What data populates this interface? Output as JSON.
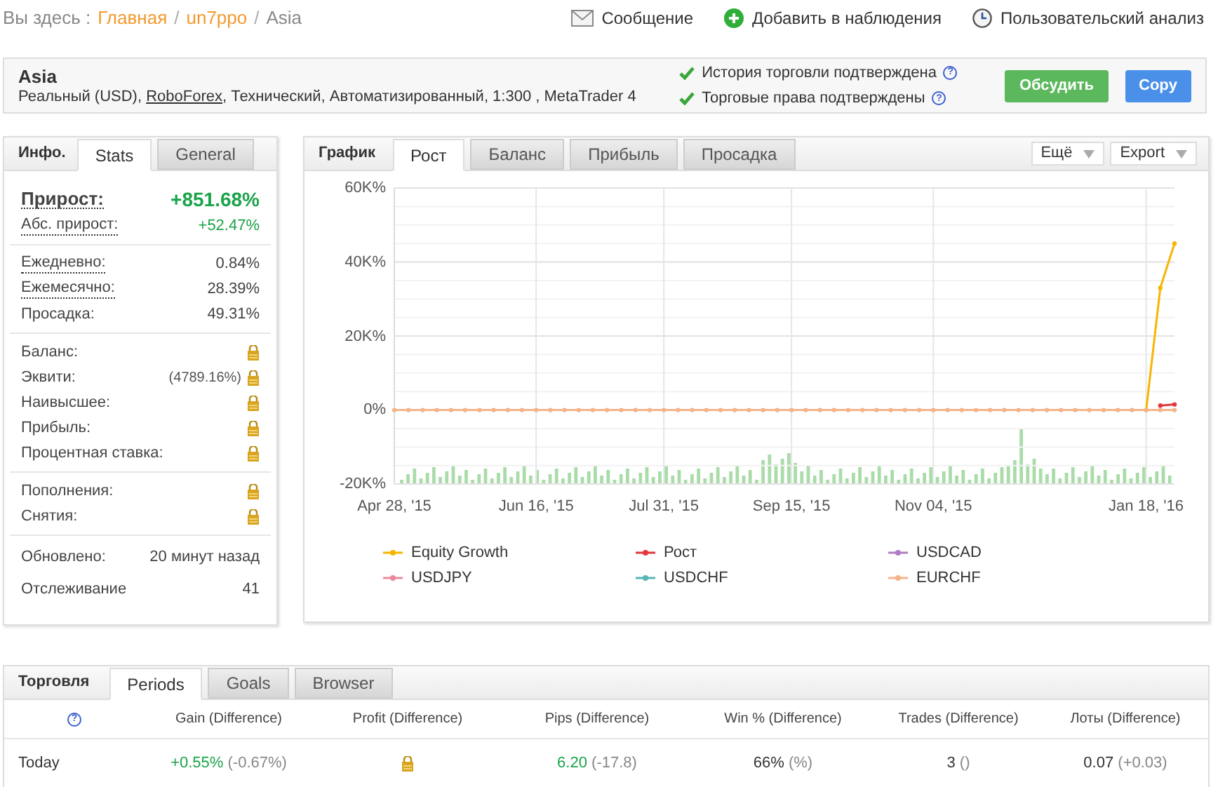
{
  "breadcrumb": {
    "prefix": "Вы здесь :",
    "links": [
      "Главная",
      "un7ppo"
    ],
    "current": "Asia",
    "separator": "/"
  },
  "top_actions": [
    {
      "kind": "message",
      "label": "Сообщение"
    },
    {
      "kind": "watch",
      "label": "Добавить в наблюдения"
    },
    {
      "kind": "analysis",
      "label": "Пользовательский анализ"
    }
  ],
  "account": {
    "title": "Asia",
    "details_before": "Реальный (USD),",
    "broker": "RoboForex",
    "details_after": ", Технический, Автоматизированный, 1:300 , MetaTrader 4",
    "verifications": [
      {
        "label": "История торговли подтверждена",
        "help": "?"
      },
      {
        "label": "Торговые права подтверждены",
        "help": "?"
      }
    ],
    "buttons": [
      {
        "label": "Обсудить",
        "kind": "discuss"
      },
      {
        "label": "Copy",
        "kind": "copy"
      }
    ]
  },
  "info": {
    "title": "Инфо.",
    "tabs": [
      {
        "label": "Stats",
        "selected": true
      },
      {
        "label": "General",
        "selected": false
      }
    ],
    "groups": [
      [
        {
          "label": "Прирост:",
          "value": "+851.68%",
          "kind": "headline",
          "underlined": true
        },
        {
          "label": "Абс. прирост:",
          "value": "+52.47%",
          "kind": "positive",
          "underlined": true
        }
      ],
      [
        {
          "label": "Ежедневно:",
          "value": "0.84%",
          "kind": "plain",
          "underlined": true
        },
        {
          "label": "Ежемесячно:",
          "value": "28.39%",
          "kind": "plain",
          "underlined": true
        },
        {
          "label": "Просадка:",
          "value": "49.31%",
          "kind": "plain",
          "underlined": false
        }
      ],
      [
        {
          "label": "Баланс:",
          "kind": "locked",
          "underlined": false
        },
        {
          "label": "Эквити:",
          "value": "(4789.16%)",
          "kind": "locked",
          "underlined": false
        },
        {
          "label": "Наивысшее:",
          "kind": "locked",
          "underlined": false
        },
        {
          "label": "Прибыль:",
          "kind": "locked",
          "underlined": false
        },
        {
          "label": "Процентная ставка:",
          "kind": "locked",
          "underlined": false
        }
      ],
      [
        {
          "label": "Пополнения:",
          "kind": "locked",
          "underlined": false
        },
        {
          "label": "Снятия:",
          "kind": "locked",
          "underlined": false
        }
      ],
      [
        {
          "label": "Обновлено:",
          "value": "20 минут назад",
          "kind": "plain",
          "underlined": false
        },
        {
          "label": "Отслеживание",
          "value": "41",
          "kind": "plain",
          "underlined": false
        }
      ]
    ]
  },
  "chart_panel": {
    "title": "График",
    "tabs": [
      {
        "label": "Рост",
        "selected": true
      },
      {
        "label": "Баланс",
        "selected": false
      },
      {
        "label": "Прибыль",
        "selected": false
      },
      {
        "label": "Просадка",
        "selected": false
      }
    ],
    "menus": [
      "Ещё",
      "Export"
    ],
    "chart_data": {
      "type": "line",
      "categories": [
        "Apr 28, '15",
        null,
        null,
        null,
        null,
        null,
        null,
        null,
        null,
        null,
        "Jun 16, '15",
        null,
        null,
        null,
        null,
        null,
        null,
        null,
        null,
        "Jul 31, '15",
        null,
        null,
        null,
        null,
        null,
        null,
        null,
        null,
        "Sep 15, '15",
        null,
        null,
        null,
        null,
        null,
        null,
        null,
        null,
        null,
        "Nov 04, '15",
        null,
        null,
        null,
        null,
        null,
        null,
        null,
        null,
        null,
        null,
        null,
        null,
        null,
        null,
        "Jan 18, '16",
        null,
        null
      ],
      "ylim": [
        -20000,
        60000
      ],
      "grid": true,
      "yticks": [
        {
          "value": -20000,
          "label": "-20K%"
        },
        {
          "value": 0,
          "label": "0%"
        },
        {
          "value": 20000,
          "label": "20K%"
        },
        {
          "value": 40000,
          "label": "40K%"
        },
        {
          "value": 60000,
          "label": "60K%"
        }
      ],
      "series": [
        {
          "name": "Equity Growth",
          "color": "#f7b500",
          "marker": true,
          "values": [
            null,
            null,
            null,
            null,
            null,
            null,
            null,
            null,
            null,
            null,
            null,
            null,
            null,
            null,
            null,
            null,
            null,
            null,
            null,
            null,
            null,
            null,
            null,
            null,
            null,
            null,
            null,
            null,
            null,
            null,
            null,
            null,
            null,
            null,
            null,
            null,
            null,
            null,
            null,
            null,
            null,
            null,
            null,
            null,
            null,
            null,
            null,
            null,
            null,
            null,
            null,
            null,
            null,
            0,
            33000,
            45000
          ]
        },
        {
          "name": "Рост",
          "color": "#e0383e",
          "marker": true,
          "values": [
            null,
            null,
            null,
            null,
            null,
            null,
            null,
            null,
            null,
            null,
            null,
            null,
            null,
            null,
            null,
            null,
            null,
            null,
            null,
            null,
            null,
            null,
            null,
            null,
            null,
            null,
            null,
            null,
            null,
            null,
            null,
            null,
            null,
            null,
            null,
            null,
            null,
            null,
            null,
            null,
            null,
            null,
            null,
            null,
            null,
            null,
            null,
            null,
            null,
            null,
            null,
            null,
            null,
            null,
            1200,
            1500
          ]
        },
        {
          "name": "USDCAD",
          "color": "#b07cc6",
          "marker": true,
          "values": [
            null,
            null,
            null,
            null,
            null,
            null,
            null,
            null,
            null,
            null,
            null,
            null,
            null,
            null,
            null,
            null,
            null,
            null,
            null,
            null,
            null,
            null,
            null,
            null,
            null,
            null,
            null,
            null,
            null,
            null,
            null,
            null,
            null,
            null,
            null,
            null,
            null,
            null,
            null,
            null,
            null,
            null,
            null,
            null,
            null,
            null,
            null,
            null,
            null,
            null,
            null,
            null,
            null,
            null,
            null,
            null
          ]
        },
        {
          "name": "USDJPY",
          "color": "#e88a9a",
          "marker": true,
          "values": [
            null,
            null,
            null,
            null,
            null,
            null,
            null,
            null,
            null,
            null,
            null,
            null,
            null,
            null,
            null,
            null,
            null,
            null,
            null,
            null,
            null,
            null,
            null,
            null,
            null,
            null,
            null,
            null,
            null,
            null,
            null,
            null,
            null,
            null,
            null,
            null,
            null,
            null,
            null,
            null,
            null,
            null,
            null,
            null,
            null,
            null,
            null,
            null,
            null,
            null,
            null,
            null,
            null,
            null,
            null,
            null
          ]
        },
        {
          "name": "USDCHF",
          "color": "#5ab5b5",
          "marker": true,
          "values": [
            null,
            null,
            null,
            null,
            null,
            null,
            null,
            null,
            null,
            null,
            null,
            null,
            null,
            null,
            null,
            null,
            null,
            null,
            null,
            null,
            null,
            null,
            null,
            null,
            null,
            null,
            null,
            null,
            null,
            null,
            null,
            null,
            null,
            null,
            null,
            null,
            null,
            null,
            null,
            null,
            null,
            null,
            null,
            null,
            null,
            null,
            null,
            null,
            null,
            null,
            null,
            null,
            null,
            null,
            null,
            null
          ]
        },
        {
          "name": "EURCHF",
          "color": "#f4b48a",
          "marker": true,
          "values": [
            0,
            0,
            0,
            0,
            0,
            0,
            0,
            0,
            0,
            0,
            0,
            0,
            0,
            0,
            0,
            0,
            0,
            0,
            0,
            0,
            0,
            0,
            0,
            0,
            0,
            0,
            0,
            0,
            0,
            0,
            0,
            0,
            0,
            0,
            0,
            0,
            0,
            0,
            0,
            0,
            0,
            0,
            0,
            0,
            0,
            0,
            0,
            0,
            0,
            0,
            0,
            0,
            0,
            0,
            0,
            0
          ]
        }
      ]
    }
  },
  "trading": {
    "title": "Торговля",
    "tabs": [
      {
        "label": "Periods",
        "selected": true
      },
      {
        "label": "Goals",
        "selected": false
      },
      {
        "label": "Browser",
        "selected": false
      }
    ],
    "columns": [
      {
        "help": "?"
      },
      {
        "label": "Gain (Difference)"
      },
      {
        "label": "Profit (Difference)"
      },
      {
        "label": "Pips (Difference)"
      },
      {
        "label": "Win % (Difference)"
      },
      {
        "label": "Trades (Difference)"
      },
      {
        "label": "Лоты (Difference)"
      }
    ],
    "rows": [
      {
        "cells": [
          {
            "kind": "period",
            "value": "Today"
          },
          {
            "kind": "positive",
            "value": "+0.55%",
            "diff": "(-0.67%)"
          },
          {
            "kind": "locked"
          },
          {
            "kind": "positive",
            "value": "6.20",
            "diff": "(-17.8)"
          },
          {
            "kind": "plain",
            "value": "66%",
            "diff": "(%)"
          },
          {
            "kind": "plain",
            "value": "3",
            "diff": "()"
          },
          {
            "kind": "plain",
            "value": "0.07",
            "diff": "(+0.03)"
          }
        ]
      }
    ]
  }
}
